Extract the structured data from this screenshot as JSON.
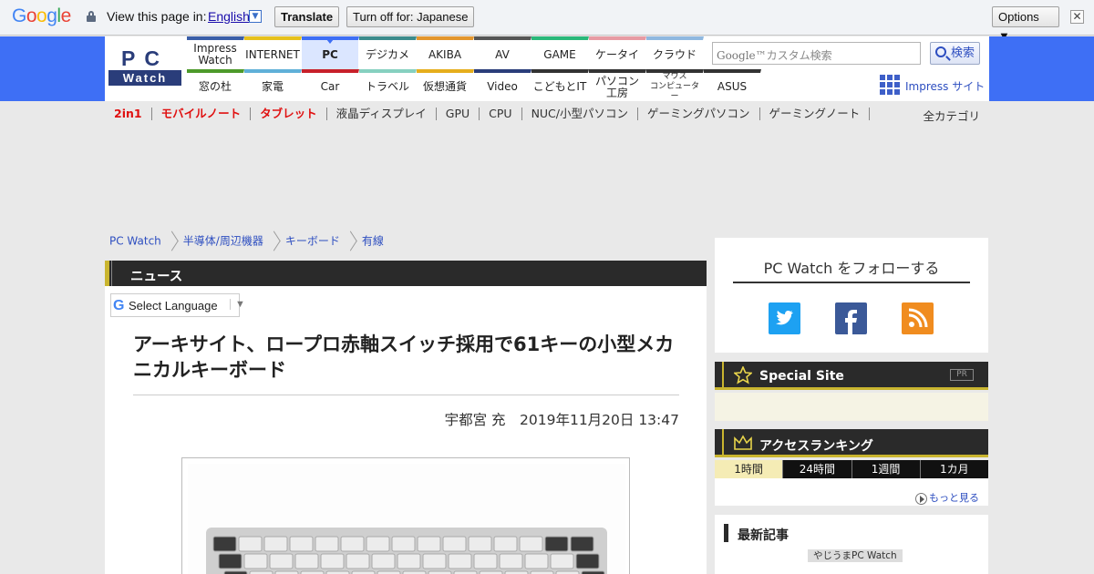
{
  "translate_bar": {
    "google_logo_letters": [
      {
        "ch": "G",
        "color": "#4285f4"
      },
      {
        "ch": "o",
        "color": "#ea4335"
      },
      {
        "ch": "o",
        "color": "#fbbc05"
      },
      {
        "ch": "g",
        "color": "#4285f4"
      },
      {
        "ch": "l",
        "color": "#34a853"
      },
      {
        "ch": "e",
        "color": "#ea4335"
      }
    ],
    "view_in_label": "View this page in:",
    "language": "English",
    "translate_button": "Translate",
    "turn_off_button": "Turn off for: Japanese",
    "options_button": "Options ▼",
    "close_glyph": "✕"
  },
  "header": {
    "logo_top": "PC",
    "logo_bottom": "Watch",
    "nav_top": [
      {
        "label": "Impress\nWatch",
        "color": "#3a5ea8"
      },
      {
        "label": "INTERNET",
        "color": "#e6c11c"
      },
      {
        "label": "PC",
        "color": "#3e6ff5",
        "active": true
      },
      {
        "label": "デジカメ",
        "color": "#3b8b8c"
      },
      {
        "label": "AKIBA",
        "color": "#e3962d"
      },
      {
        "label": "AV",
        "color": "#555555"
      },
      {
        "label": "GAME",
        "color": "#2ab87a"
      },
      {
        "label": "ケータイ",
        "color": "#e79aa3"
      },
      {
        "label": "クラウド",
        "color": "#8fb8e0"
      }
    ],
    "nav_bottom": [
      {
        "label": "窓の杜",
        "color": "#4d9a2a"
      },
      {
        "label": "家電",
        "color": "#5fb0d8"
      },
      {
        "label": "Car",
        "color": "#c8202a"
      },
      {
        "label": "トラベル",
        "color": "#86d0c0"
      },
      {
        "label": "仮想通貨",
        "color": "#e6ae1c"
      },
      {
        "label": "Video",
        "color": "#2a3d7a"
      },
      {
        "label": "こどもとIT",
        "color": "#333333"
      },
      {
        "label": "パソコン\n工房",
        "color": "#333333"
      },
      {
        "label": "マウス\nコンピューター",
        "color": "#333333",
        "small": true
      },
      {
        "label": "ASUS",
        "color": "#333333"
      }
    ],
    "search_brand": "Google™",
    "search_placeholder": "カスタム検索",
    "search_button": "検索",
    "impress_site": "Impress サイト"
  },
  "categories": {
    "items": [
      {
        "label": "2in1",
        "red": true
      },
      {
        "label": "モバイルノート",
        "red": true
      },
      {
        "label": "タブレット",
        "red": true
      },
      {
        "label": "液晶ディスプレイ"
      },
      {
        "label": "GPU"
      },
      {
        "label": "CPU"
      },
      {
        "label": "NUC/小型パソコン"
      },
      {
        "label": "ゲーミングパソコン"
      },
      {
        "label": "ゲーミングノート"
      }
    ],
    "all": "全カテゴリ"
  },
  "breadcrumb": [
    "PC Watch",
    "半導体/周辺機器",
    "キーボード",
    "有線"
  ],
  "article": {
    "section": "ニュース",
    "select_language": "Select Language",
    "select_arrow": "▼",
    "title": "アーキサイト、ロープロ赤軸スイッチ採用で61キーの小型メカニカルキーボード",
    "byline": "宇都宮 充　2019年11月20日 13:47"
  },
  "sidebar": {
    "follow_title": "PC Watch をフォローする",
    "social_icons": [
      "twitter-icon",
      "facebook-icon",
      "rss-icon"
    ],
    "special_site": "Special Site",
    "pr_badge": "PR",
    "ranking_title": "アクセスランキング",
    "ranking_tabs": [
      "1時間",
      "24時間",
      "1週間",
      "1カ月"
    ],
    "more_label": "もっと見る",
    "latest_title": "最新記事",
    "latest_tag": "やじうまPC Watch"
  }
}
